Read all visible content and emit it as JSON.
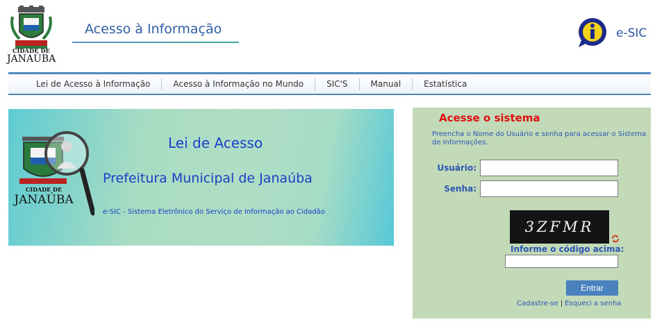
{
  "header": {
    "crest_caption_top": "CIDADE DE",
    "crest_caption_city": "JANAÚBA",
    "site_title": "Acesso à Informação",
    "esic_icon": "info-bubble-icon",
    "esic_label": "e-SIC"
  },
  "nav": {
    "items": [
      {
        "label": "Lei de Acesso à Informação"
      },
      {
        "label": "Acesso à Informação no Mundo"
      },
      {
        "label": "SIC'S"
      },
      {
        "label": "Manual"
      },
      {
        "label": "Estatística"
      }
    ]
  },
  "banner": {
    "city_top": "CIDADE DE",
    "city_name": "JANAÚBA",
    "heading": "Lei de Acesso",
    "subheading": "Prefeitura Municipal de Janaúba",
    "caption": "e-SIC - Sistema Eletrônico do Serviço de Informação ao Cidadão"
  },
  "login": {
    "title": "Acesse o sistema",
    "description": "Preencha o Nome do Usuário e senha para acessar o Sistema de Informações.",
    "user_label": "Usuário:",
    "user_value": "",
    "password_label": "Senha:",
    "password_value": "",
    "captcha_text": "3ZFMR",
    "refresh_icon": "refresh-icon",
    "captcha_label": "Informe o código acima:",
    "captcha_value": "",
    "submit_label": "Entrar",
    "register_link": "Cadastre-se",
    "link_separator": "|",
    "forgot_link": "Esqueci a senha"
  },
  "colors": {
    "accent_blue": "#2d56b3",
    "title_red": "#e01010",
    "nav_line": "#4f86c0",
    "login_bg": "#c2dab8",
    "button_bg": "#4a82c0"
  }
}
